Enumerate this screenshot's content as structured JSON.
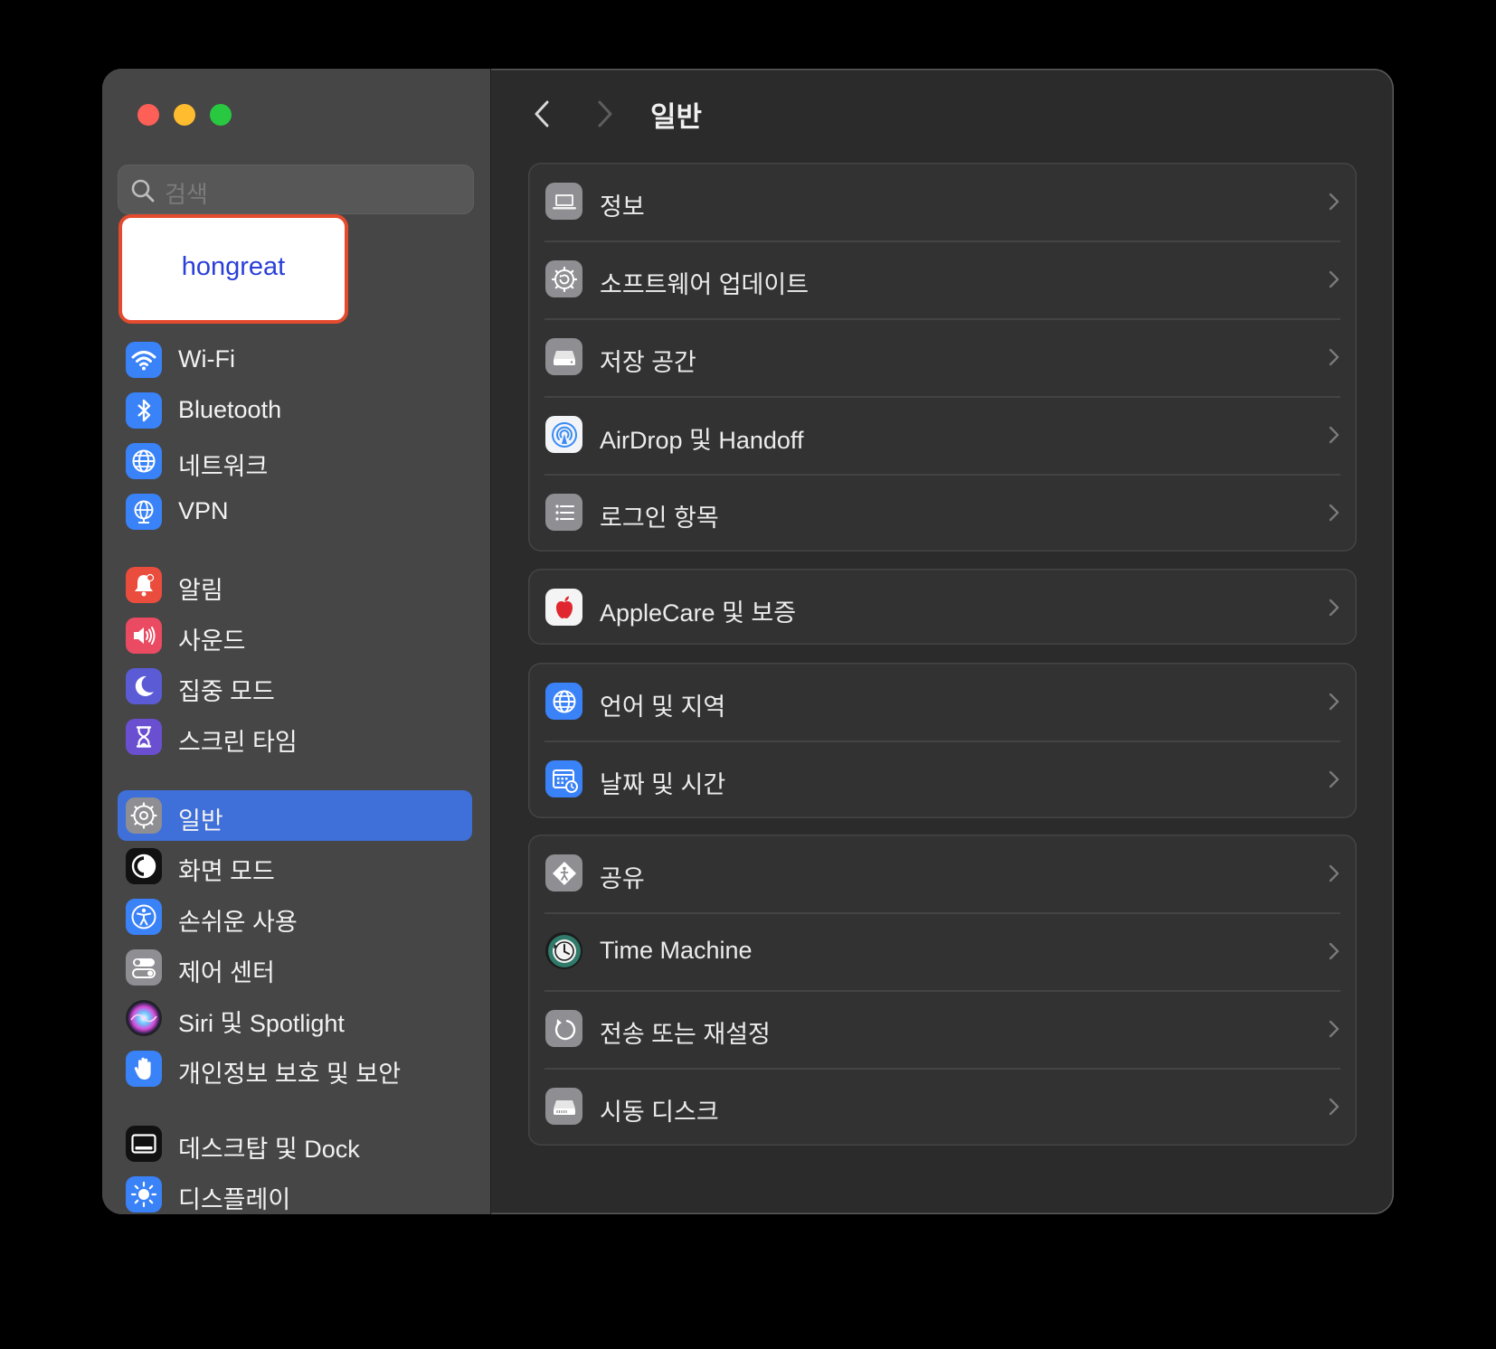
{
  "window": {
    "title": "일반"
  },
  "search": {
    "placeholder": "검색"
  },
  "profile": {
    "name": "hongreat"
  },
  "sidebar": {
    "items": [
      {
        "label": "Wi-Fi",
        "icon": "wifi-icon",
        "color": "#3a82f7"
      },
      {
        "label": "Bluetooth",
        "icon": "bluetooth-icon",
        "color": "#3a82f7"
      },
      {
        "label": "네트워크",
        "icon": "globe-icon",
        "color": "#3a82f7"
      },
      {
        "label": "VPN",
        "icon": "vpn-globe-icon",
        "color": "#3a82f7"
      },
      {
        "label": "알림",
        "icon": "bell-icon",
        "color": "#ea4d3d"
      },
      {
        "label": "사운드",
        "icon": "speaker-icon",
        "color": "#ea4b63"
      },
      {
        "label": "집중 모드",
        "icon": "moon-icon",
        "color": "#5b5bd6"
      },
      {
        "label": "스크린 타임",
        "icon": "hourglass-icon",
        "color": "#6a4fd1"
      },
      {
        "label": "일반",
        "icon": "gear-icon",
        "color": "#8e8e93",
        "active": true
      },
      {
        "label": "화면 모드",
        "icon": "appearance-icon",
        "color": "#111111"
      },
      {
        "label": "손쉬운 사용",
        "icon": "accessibility-icon",
        "color": "#3a82f7"
      },
      {
        "label": "제어 센터",
        "icon": "toggles-icon",
        "color": "#8e8e93"
      },
      {
        "label": "Siri 및 Spotlight",
        "icon": "siri-icon",
        "color": "#222222"
      },
      {
        "label": "개인정보 보호 및 보안",
        "icon": "hand-icon",
        "color": "#3a82f7"
      },
      {
        "label": "데스크탑 및 Dock",
        "icon": "dock-icon",
        "color": "#111111"
      },
      {
        "label": "디스플레이",
        "icon": "sun-icon",
        "color": "#3a82f7"
      }
    ]
  },
  "groups": [
    {
      "rows": [
        {
          "label": "정보",
          "icon": "laptop-icon"
        },
        {
          "label": "소프트웨어 업데이트",
          "icon": "gear-update-icon"
        },
        {
          "label": "저장 공간",
          "icon": "drive-icon"
        },
        {
          "label": "AirDrop 및 Handoff",
          "icon": "airdrop-icon"
        },
        {
          "label": "로그인 항목",
          "icon": "list-icon"
        }
      ]
    },
    {
      "rows": [
        {
          "label": "AppleCare 및 보증",
          "icon": "apple-icon"
        }
      ]
    },
    {
      "rows": [
        {
          "label": "언어 및 지역",
          "icon": "globe-icon"
        },
        {
          "label": "날짜 및 시간",
          "icon": "calendar-clock-icon"
        }
      ]
    },
    {
      "rows": [
        {
          "label": "공유",
          "icon": "sharing-icon"
        },
        {
          "label": "Time Machine",
          "icon": "time-machine-icon"
        },
        {
          "label": "전송 또는 재설정",
          "icon": "reset-icon"
        },
        {
          "label": "시동 디스크",
          "icon": "startup-disk-icon"
        }
      ]
    }
  ]
}
